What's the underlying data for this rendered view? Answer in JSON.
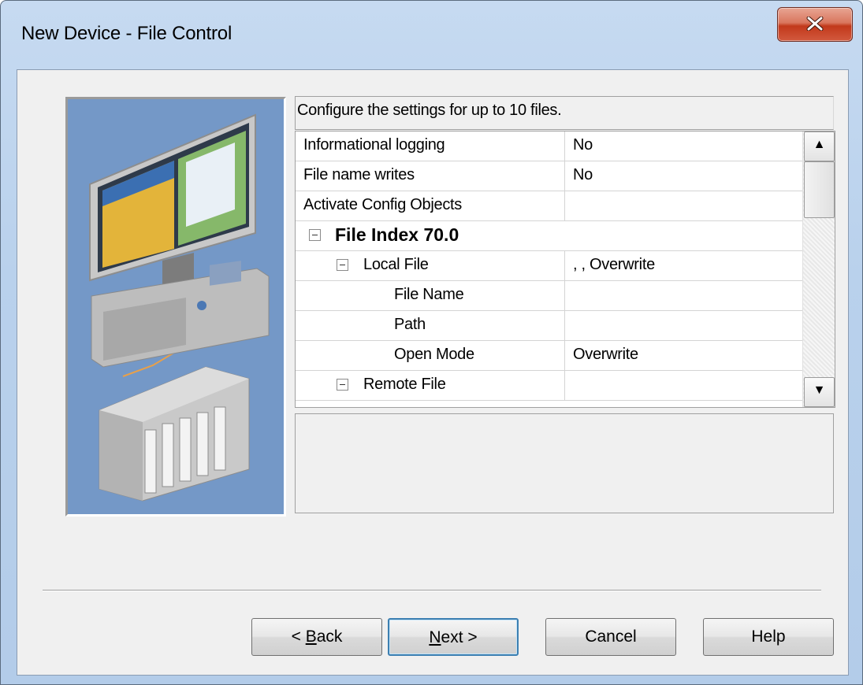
{
  "window": {
    "title": "New Device - File Control",
    "close_glyph": "close-icon"
  },
  "hint": "Configure the settings for up to 10 files.",
  "grid": {
    "rows": [
      {
        "name": "Informational logging",
        "value": "No",
        "kind": "property"
      },
      {
        "name": "File name writes",
        "value": "No",
        "kind": "property"
      },
      {
        "name": "Activate Config Objects",
        "value": "",
        "kind": "property"
      },
      {
        "name": "File Index 70.0",
        "value": "",
        "kind": "category",
        "expanded": true
      },
      {
        "name": "Local File",
        "value": ", , Overwrite",
        "kind": "subcategory",
        "expanded": true
      },
      {
        "name": "File Name",
        "value": "",
        "kind": "property"
      },
      {
        "name": "Path",
        "value": "",
        "kind": "property"
      },
      {
        "name": "Open Mode",
        "value": "Overwrite",
        "kind": "property"
      },
      {
        "name": "Remote File",
        "value": "",
        "kind": "subcategory",
        "expanded": true
      }
    ],
    "scroll_up_glyph": "▲",
    "scroll_down_glyph": "▼"
  },
  "description": "",
  "buttons": {
    "back": {
      "pre": "< ",
      "mnemonic": "B",
      "rest": "ack"
    },
    "next": {
      "pre": "",
      "mnemonic": "N",
      "rest": "ext >"
    },
    "cancel": "Cancel",
    "help": "Help"
  },
  "colors": {
    "illustration_bg": "#7498c7",
    "close_button": "#c2391b",
    "default_button_border": "#3c7fb1"
  }
}
